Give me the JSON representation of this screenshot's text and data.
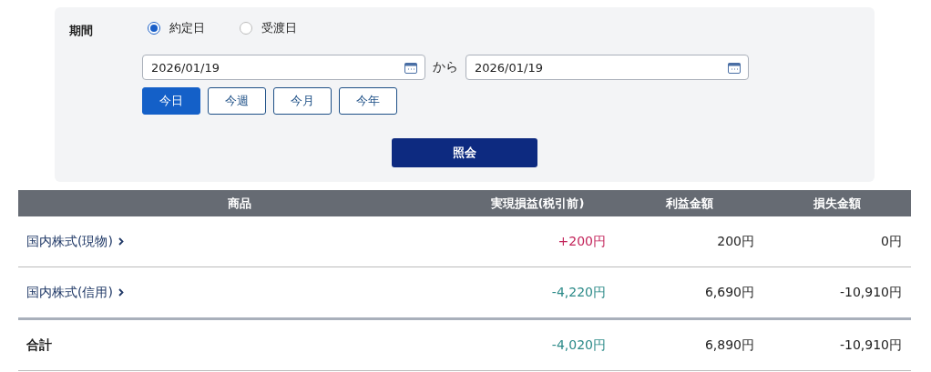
{
  "filter": {
    "label": "期間",
    "date_types": [
      {
        "label": "約定日",
        "selected": true
      },
      {
        "label": "受渡日",
        "selected": false
      }
    ],
    "from_date": "2026/01/19",
    "separator": "から",
    "to_date": "2026/01/19",
    "presets": [
      {
        "label": "今日",
        "selected": true
      },
      {
        "label": "今週",
        "selected": false
      },
      {
        "label": "今月",
        "selected": false
      },
      {
        "label": "今年",
        "selected": false
      }
    ],
    "submit": "照会"
  },
  "table": {
    "columns": [
      "商品",
      "実現損益(税引前)",
      "利益金額",
      "損失金額"
    ],
    "rows": [
      {
        "product": "国内株式(現物)",
        "realized": "+200円",
        "color": "#c3245a",
        "profit": "200円",
        "loss": "0円"
      },
      {
        "product": "国内株式(信用)",
        "realized": "-4,220円",
        "color": "#2b8a88",
        "profit": "6,690円",
        "loss": "-10,910円"
      }
    ],
    "total": {
      "label": "合計",
      "realized": "-4,020円",
      "color": "#2b8a88",
      "profit": "6,890円",
      "loss": "-10,910円"
    }
  }
}
